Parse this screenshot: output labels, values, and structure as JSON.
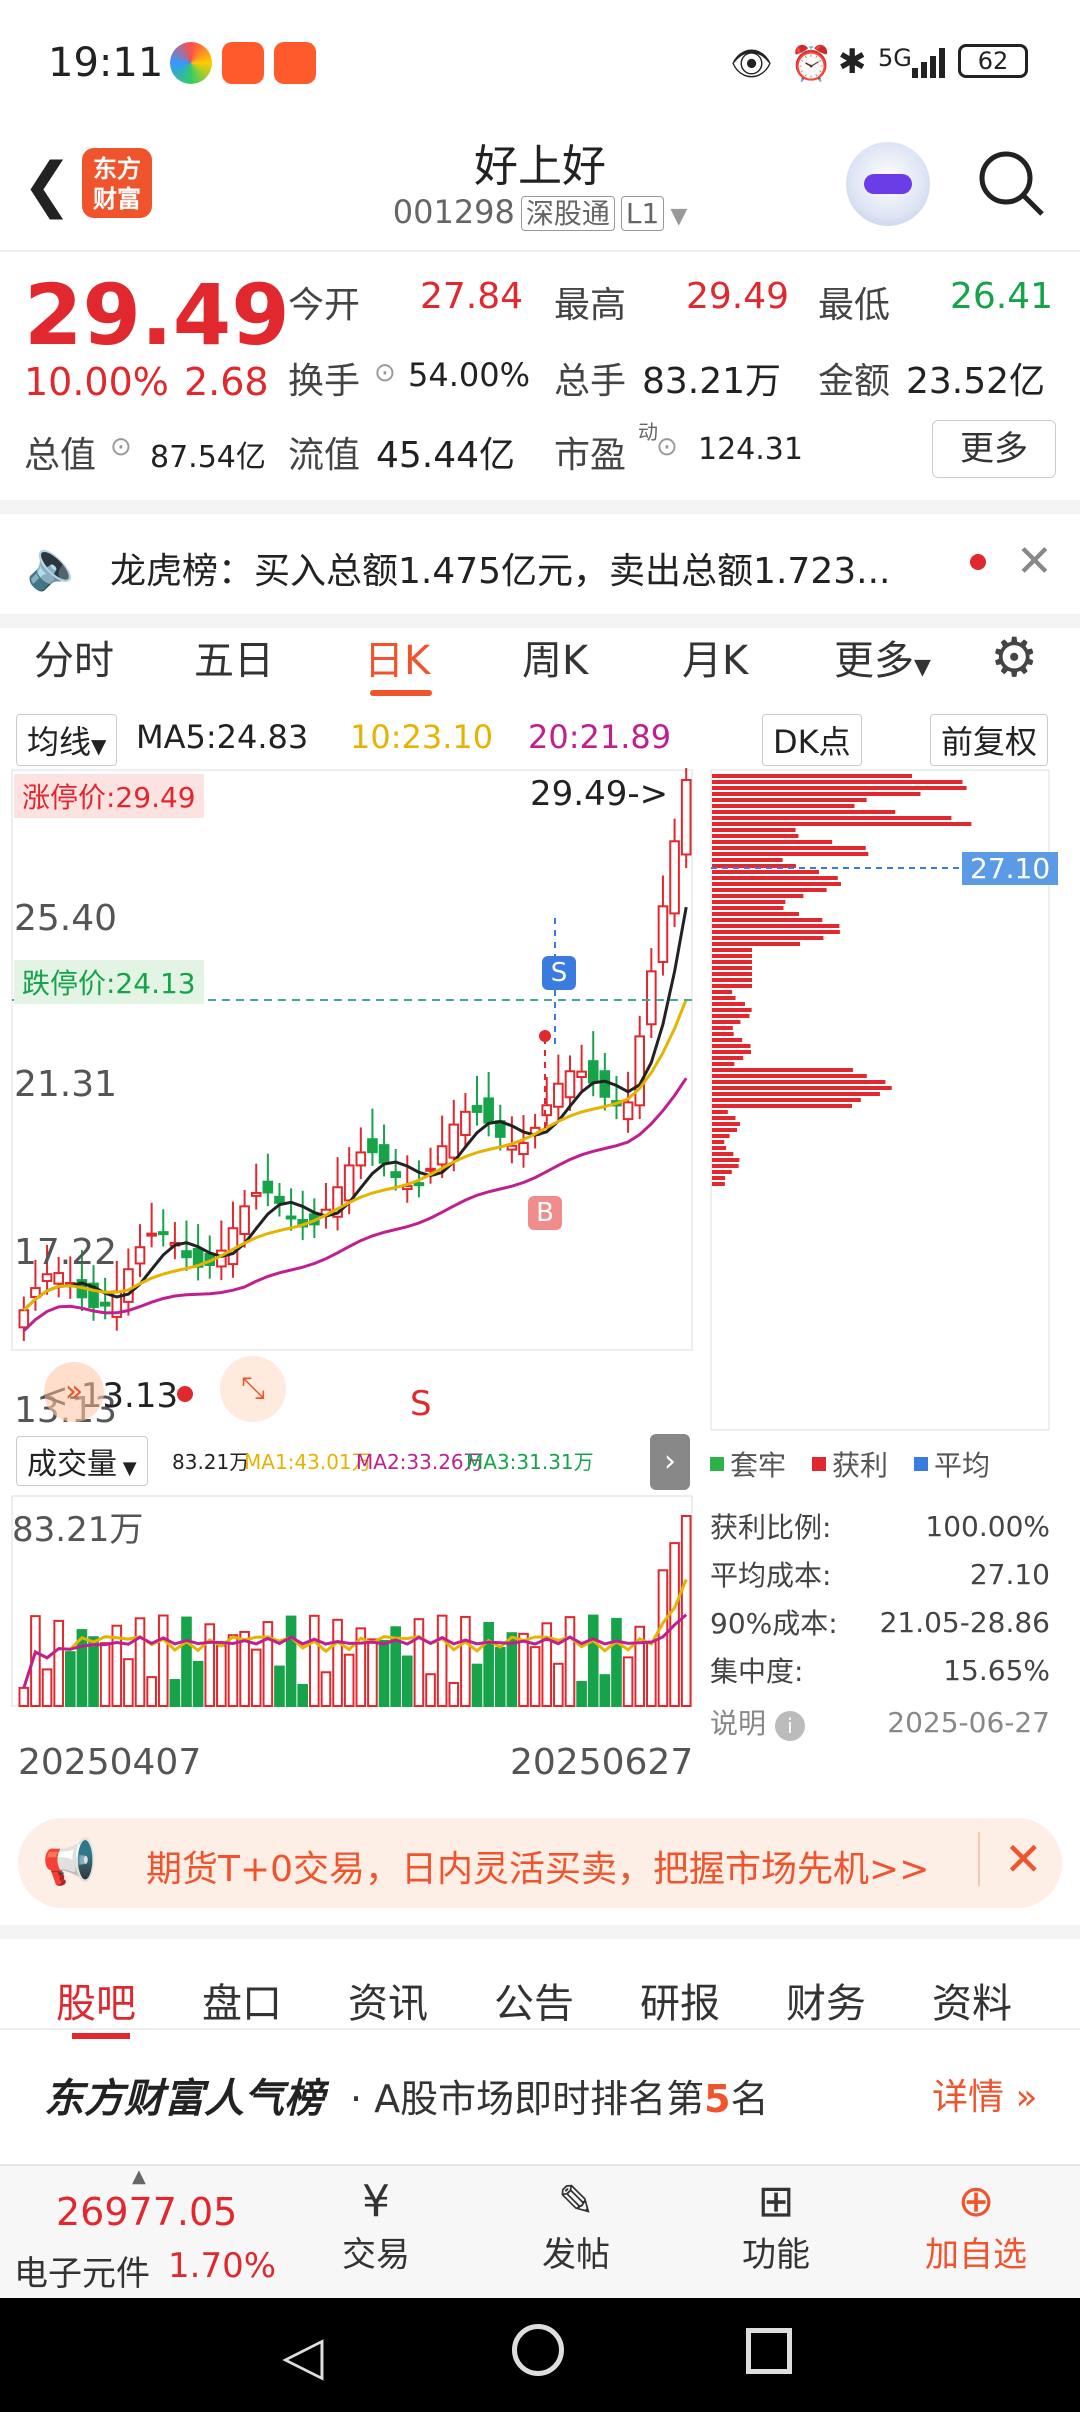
{
  "status": {
    "time": "19:11",
    "battery": "62",
    "network": "5G"
  },
  "header": {
    "title": "好上好",
    "code": "001298",
    "tag1": "深股通",
    "tag2": "L1",
    "logo_line1": "东方",
    "logo_line2": "财富"
  },
  "quote": {
    "price": "29.49",
    "change_pct": "10.00%",
    "change": "2.68",
    "open_label": "今开",
    "open": "27.84",
    "high_label": "最高",
    "high": "29.49",
    "low_label": "最低",
    "low": "26.41",
    "turnover_label": "换手",
    "turnover": "54.00%",
    "volume_label": "总手",
    "volume": "83.21万",
    "amount_label": "金额",
    "amount": "23.52亿",
    "mcap_label": "总值",
    "mcap": "87.54亿",
    "float_label": "流值",
    "float": "45.44亿",
    "pe_label": "市盈",
    "pe_sup": "动",
    "pe": "124.31",
    "more": "更多"
  },
  "notice": {
    "text": "龙虎榜：买入总额1.475亿元，卖出总额1.723..."
  },
  "ktabs": [
    "分时",
    "五日",
    "日K",
    "周K",
    "月K",
    "更多"
  ],
  "chart": {
    "ma_selector": "均线",
    "ma5": "MA5:24.83",
    "ma10": "10:23.10",
    "ma20": "20:21.89",
    "dk": "DK点",
    "adjust": "前复权",
    "limit_up": "涨停价:29.49",
    "limit_down": "跌停价:24.13",
    "y_top": "29.49->",
    "y_labels": [
      "25.40",
      "21.31",
      "17.22",
      "13.13"
    ],
    "low_marker": "<-13.13",
    "s_label": "S",
    "b_label": "B",
    "chip_avg": "27.10",
    "vol_selector": "成交量",
    "vol_ma": "83.21万",
    "vol_ma1": "MA1:43.01万",
    "vol_ma2": "MA2:33.26万",
    "vol_ma3": "MA3:31.31万",
    "vol_max": "83.21万",
    "date_start": "20250407",
    "date_end": "20250627"
  },
  "chips": {
    "legend": [
      "套牢",
      "获利",
      "平均"
    ],
    "rows": [
      {
        "label": "获利比例:",
        "value": "100.00%"
      },
      {
        "label": "平均成本:",
        "value": "27.10"
      },
      {
        "label": "90%成本:",
        "value": "21.05-28.86"
      },
      {
        "label": "集中度:",
        "value": "15.65%"
      }
    ],
    "note": "说明",
    "date": "2025-06-27"
  },
  "promo": {
    "text": "期货T+0交易，日内灵活买卖，把握市场先机>>"
  },
  "btabs": [
    "股吧",
    "盘口",
    "资讯",
    "公告",
    "研报",
    "财务",
    "资料"
  ],
  "rank": {
    "brand": "东方财富人气榜",
    "text_pre": "· A股市场即时排名第",
    "num": "5",
    "text_post": "名",
    "detail": "详情"
  },
  "footer": {
    "index_value": "26977.05",
    "index_name": "电子元件",
    "index_pct": "1.70%",
    "trade": "交易",
    "post": "发帖",
    "func": "功能",
    "add": "加自选"
  },
  "chart_data": {
    "type": "candlestick",
    "x_start": "20250407",
    "x_end": "20250627",
    "ylim": [
      13.13,
      29.49
    ],
    "y_ticks": [
      25.4,
      21.31,
      17.22,
      13.13
    ],
    "last_close": 29.49,
    "volume_last": "83.21万"
  }
}
